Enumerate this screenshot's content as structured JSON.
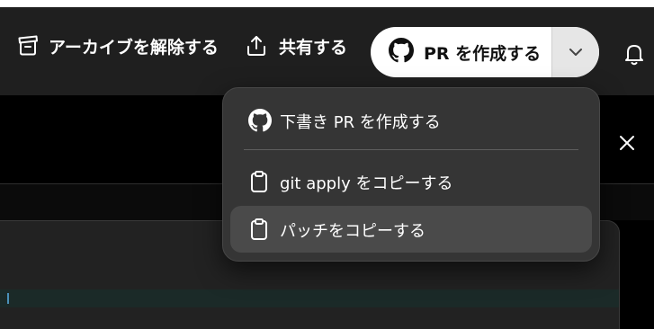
{
  "toolbar": {
    "unarchive_label": "アーカイブを解除する",
    "share_label": "共有する",
    "create_pr_label": "PR を作成する"
  },
  "pr_menu": {
    "items": [
      {
        "label": "下書き PR を作成する",
        "icon": "github-icon"
      },
      {
        "label": "git apply をコピーする",
        "icon": "clipboard-icon"
      },
      {
        "label": "パッチをコピーする",
        "icon": "clipboard-icon",
        "highlighted": true
      }
    ]
  },
  "colors": {
    "toolbar_bg": "#1f1f1f",
    "menu_bg": "#353535",
    "menu_highlight": "#4a4a4a",
    "primary_button_bg": "#ffffff",
    "dropdown_toggle_bg": "#e6e6e6"
  }
}
